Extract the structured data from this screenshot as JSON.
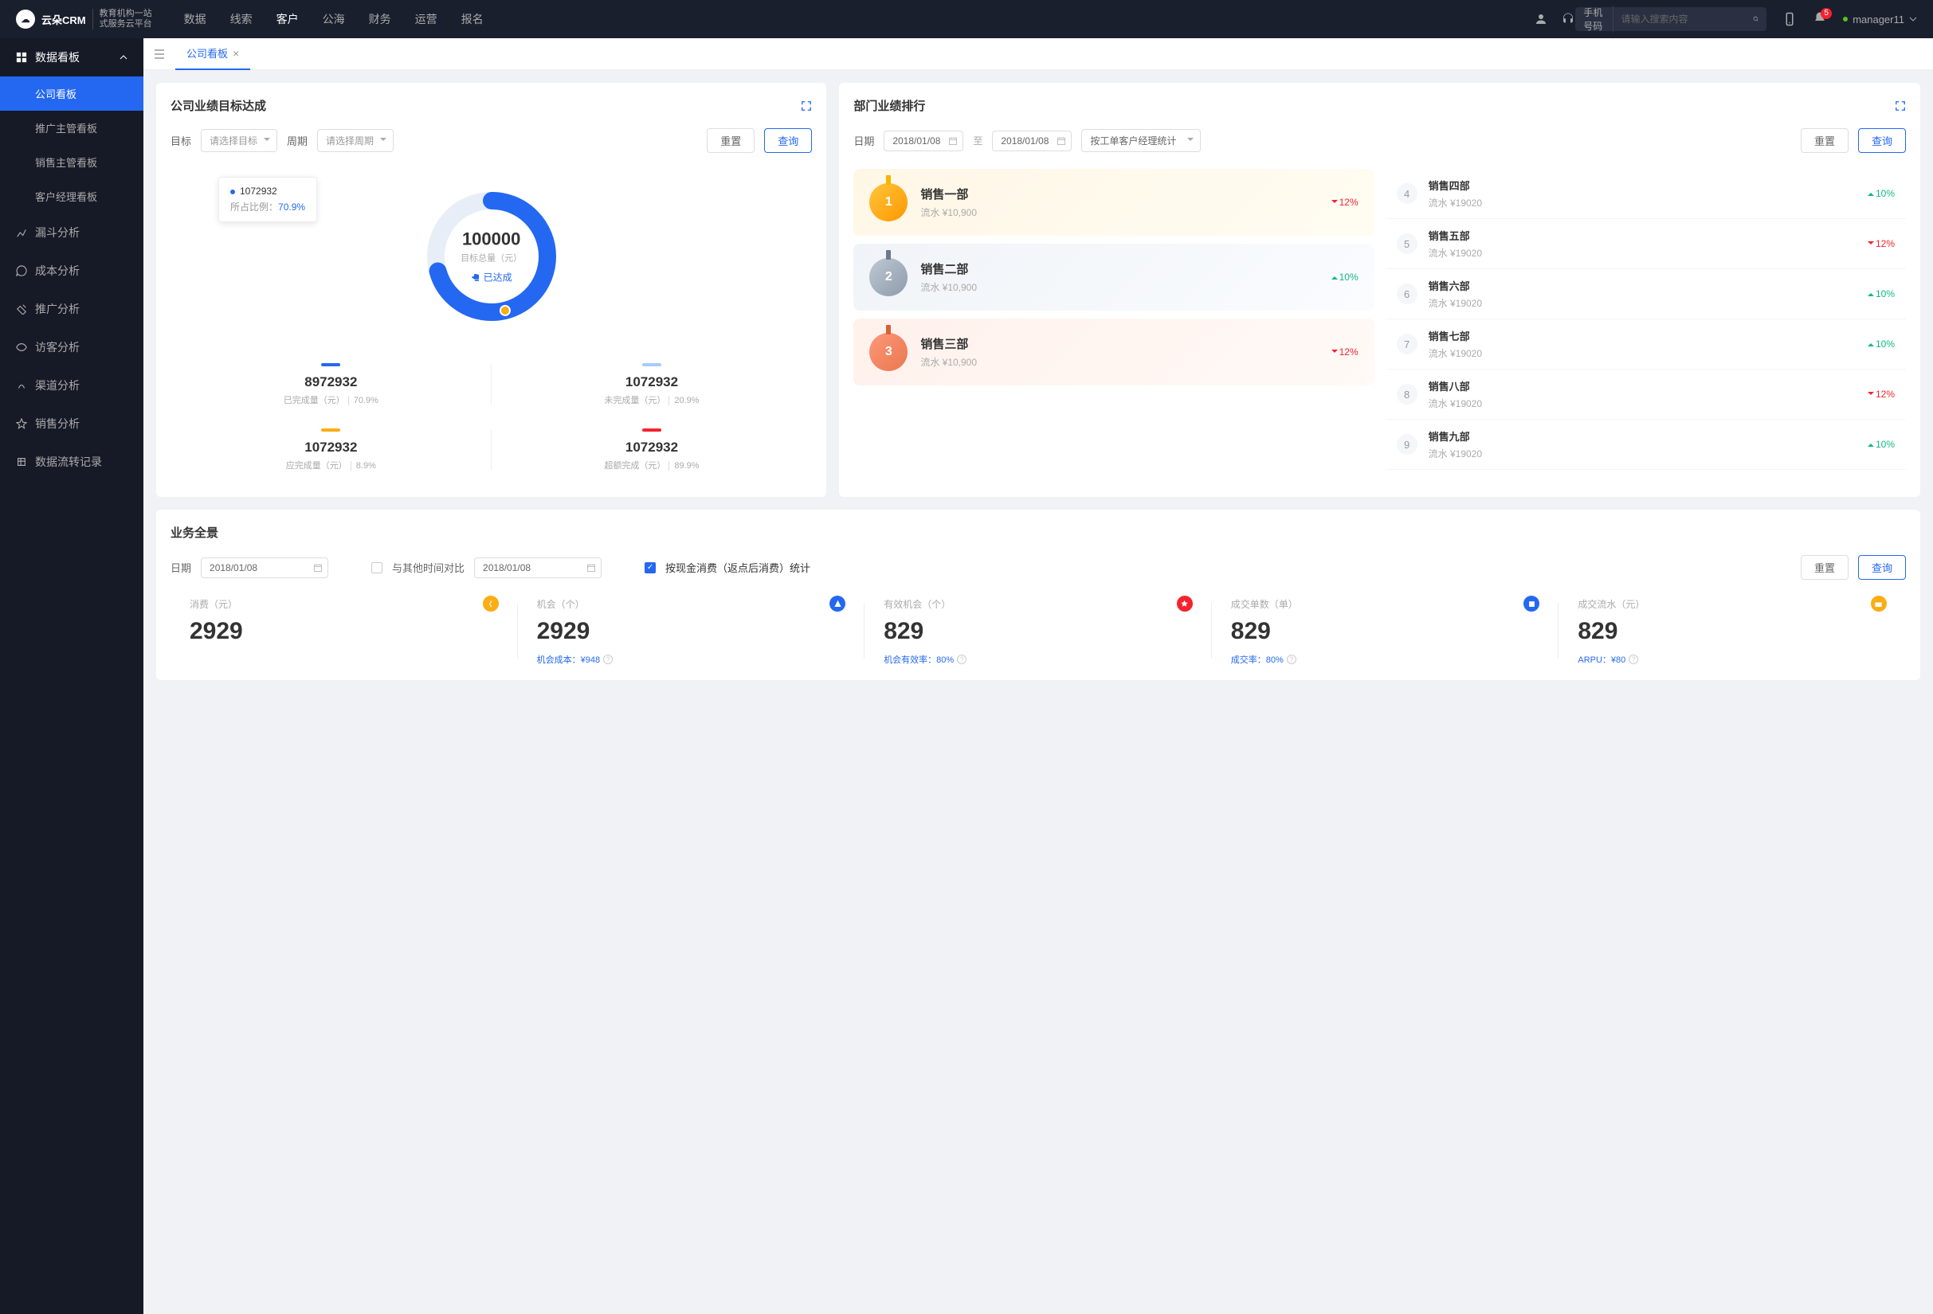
{
  "brand": {
    "name": "云朵CRM",
    "tagline1": "教育机构一站",
    "tagline2": "式服务云平台"
  },
  "nav": [
    "数据",
    "线索",
    "客户",
    "公海",
    "财务",
    "运营",
    "报名"
  ],
  "nav_active": 2,
  "search": {
    "type": "手机号码",
    "placeholder": "请输入搜索内容"
  },
  "notif_count": "5",
  "user": "manager11",
  "sidebar": {
    "group": "数据看板",
    "subs": [
      "公司看板",
      "推广主管看板",
      "销售主管看板",
      "客户经理看板"
    ],
    "items": [
      "漏斗分析",
      "成本分析",
      "推广分析",
      "访客分析",
      "渠道分析",
      "销售分析",
      "数据流转记录"
    ]
  },
  "tab": "公司看板",
  "card1": {
    "title": "公司业绩目标达成",
    "target_label": "目标",
    "target_ph": "请选择目标",
    "period_label": "周期",
    "period_ph": "请选择周期",
    "reset": "重置",
    "query": "查询",
    "tooltip_val": "1072932",
    "tooltip_label": "所占比例：",
    "tooltip_pct": "70.9%",
    "center_num": "100000",
    "center_label": "目标总量（元）",
    "center_status": "已达成",
    "stats": [
      {
        "color": "#2468f2",
        "num": "8972932",
        "label": "已完成量（元）",
        "pct": "70.9%"
      },
      {
        "color": "#a8caff",
        "num": "1072932",
        "label": "未完成量（元）",
        "pct": "20.9%"
      },
      {
        "color": "#faad14",
        "num": "1072932",
        "label": "应完成量（元）",
        "pct": "8.9%"
      },
      {
        "color": "#f5222d",
        "num": "1072932",
        "label": "超额完成（元）",
        "pct": "89.9%"
      }
    ]
  },
  "card2": {
    "title": "部门业绩排行",
    "date_label": "日期",
    "date1": "2018/01/08",
    "date_sep": "至",
    "date2": "2018/01/08",
    "stat_by": "按工单客户经理统计",
    "reset": "重置",
    "query": "查询",
    "top3": [
      {
        "rank": "1",
        "name": "销售一部",
        "sub": "流水 ¥10,900",
        "change": "12%",
        "dir": "down"
      },
      {
        "rank": "2",
        "name": "销售二部",
        "sub": "流水 ¥10,900",
        "change": "10%",
        "dir": "up"
      },
      {
        "rank": "3",
        "name": "销售三部",
        "sub": "流水 ¥10,900",
        "change": "12%",
        "dir": "down"
      }
    ],
    "rest": [
      {
        "rank": "4",
        "name": "销售四部",
        "sub": "流水 ¥19020",
        "change": "10%",
        "dir": "up"
      },
      {
        "rank": "5",
        "name": "销售五部",
        "sub": "流水 ¥19020",
        "change": "12%",
        "dir": "down"
      },
      {
        "rank": "6",
        "name": "销售六部",
        "sub": "流水 ¥19020",
        "change": "10%",
        "dir": "up"
      },
      {
        "rank": "7",
        "name": "销售七部",
        "sub": "流水 ¥19020",
        "change": "10%",
        "dir": "up"
      },
      {
        "rank": "8",
        "name": "销售八部",
        "sub": "流水 ¥19020",
        "change": "12%",
        "dir": "down"
      },
      {
        "rank": "9",
        "name": "销售九部",
        "sub": "流水 ¥19020",
        "change": "10%",
        "dir": "up"
      }
    ]
  },
  "card3": {
    "title": "业务全景",
    "date_label": "日期",
    "date1": "2018/01/08",
    "compare_label": "与其他时间对比",
    "date2": "2018/01/08",
    "opt_label": "按现金消费（返点后消费）统计",
    "reset": "重置",
    "query": "查询",
    "items": [
      {
        "label": "消费（元）",
        "num": "2929",
        "sub": "",
        "color": "#faad14"
      },
      {
        "label": "机会（个）",
        "num": "2929",
        "sub": "机会成本：¥948",
        "color": "#2468f2"
      },
      {
        "label": "有效机会（个）",
        "num": "829",
        "sub": "机会有效率：80%",
        "color": "#f5222d"
      },
      {
        "label": "成交单数（单）",
        "num": "829",
        "sub": "成交率：80%",
        "color": "#2468f2"
      },
      {
        "label": "成交流水（元）",
        "num": "829",
        "sub": "ARPU：¥80",
        "color": "#faad14"
      }
    ]
  },
  "chart_data": {
    "type": "pie",
    "title": "目标总量（元）",
    "total": 100000,
    "series": [
      {
        "name": "已完成量",
        "value": 8972932,
        "pct": 70.9,
        "color": "#2468f2"
      },
      {
        "name": "未完成量",
        "value": 1072932,
        "pct": 20.9,
        "color": "#a8caff"
      },
      {
        "name": "应完成量",
        "value": 1072932,
        "pct": 8.9,
        "color": "#faad14"
      },
      {
        "name": "超额完成",
        "value": 1072932,
        "pct": 89.9,
        "color": "#f5222d"
      }
    ]
  }
}
